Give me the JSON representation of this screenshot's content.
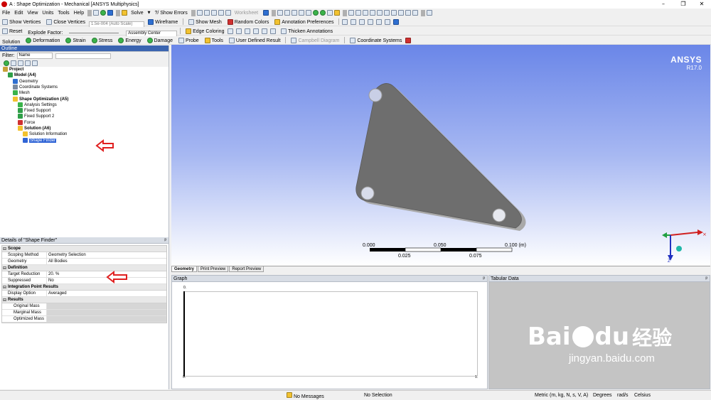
{
  "window": {
    "title": "A : Shape Optimization - Mechanical [ANSYS Multiphysics]",
    "controls": [
      "–",
      "❐",
      "✕"
    ]
  },
  "menu": [
    "File",
    "Edit",
    "View",
    "Units",
    "Tools",
    "Help"
  ],
  "toolbar1": {
    "solve": "Solve",
    "show_errors": "?/ Show Errors",
    "worksheet": "Worksheet"
  },
  "toolbar2": {
    "show_vertices": "Show Vertices",
    "close_vertices": "Close Vertices",
    "auto_scale": "1.5e-004 (Auto Scale)",
    "wireframe": "Wireframe",
    "show_mesh": "Show Mesh",
    "random_colors": "Random Colors",
    "annotation_prefs": "Annotation Preferences"
  },
  "toolbar3": {
    "reset": "Reset",
    "explode_factor": "Explode Factor:",
    "assembly_center": "Assembly Center",
    "edge_coloring": "Edge Coloring",
    "thicken_annotations": "Thicken Annotations"
  },
  "toolbar4": {
    "solution": "Solution",
    "deformation": "Deformation",
    "strain": "Strain",
    "stress": "Stress",
    "energy": "Energy",
    "damage": "Damage",
    "probe": "Probe",
    "tools": "Tools",
    "user_defined_result": "User Defined Result",
    "campbell_diagram": "Campbell Diagram",
    "coordinate_systems": "Coordinate Systems"
  },
  "outline": {
    "header": "Outline",
    "filter_label": "Filter:",
    "filter_value": "Name",
    "tree": [
      {
        "label": "Project",
        "bold": true,
        "depth": 0
      },
      {
        "label": "Model (A4)",
        "bold": true,
        "depth": 1
      },
      {
        "label": "Geometry",
        "bold": false,
        "depth": 2
      },
      {
        "label": "Coordinate Systems",
        "bold": false,
        "depth": 2
      },
      {
        "label": "Mesh",
        "bold": false,
        "depth": 2
      },
      {
        "label": "Shape Optimization (A5)",
        "bold": true,
        "depth": 2
      },
      {
        "label": "Analysis Settings",
        "bold": false,
        "depth": 3
      },
      {
        "label": "Fixed Support",
        "bold": false,
        "depth": 3
      },
      {
        "label": "Fixed Support 2",
        "bold": false,
        "depth": 3
      },
      {
        "label": "Force",
        "bold": false,
        "depth": 3
      },
      {
        "label": "Solution (A6)",
        "bold": true,
        "depth": 3
      },
      {
        "label": "Solution Information",
        "bold": false,
        "depth": 4
      },
      {
        "label": "Shape Finder",
        "bold": false,
        "depth": 4,
        "selected": true
      }
    ]
  },
  "details": {
    "header": "Details of \"Shape Finder\"",
    "pin": "ᵖ",
    "groups": [
      {
        "name": "Scope",
        "rows": [
          {
            "k": "Scoping Method",
            "v": "Geometry Selection"
          },
          {
            "k": "Geometry",
            "v": "All Bodies"
          }
        ]
      },
      {
        "name": "Definition",
        "rows": [
          {
            "k": "Target Reduction",
            "v": "20. %"
          },
          {
            "k": "Suppressed",
            "v": "No"
          }
        ]
      },
      {
        "name": "Integration Point Results",
        "rows": [
          {
            "k": "Display Option",
            "v": "Averaged"
          }
        ]
      },
      {
        "name": "Results",
        "rows": [
          {
            "k": "Original Mass",
            "v": ""
          },
          {
            "k": "Marginal Mass",
            "v": ""
          },
          {
            "k": "Optimized Mass",
            "v": ""
          }
        ]
      }
    ]
  },
  "viewport": {
    "brand": "ANSYS",
    "version": "R17.0",
    "scale_labels_top": [
      "0.000",
      "0.050",
      "0.100 (m)"
    ],
    "scale_labels_bottom": [
      "0.025",
      "0.075"
    ],
    "triad_axis": "Z",
    "tabs": [
      "Geometry",
      "Print Preview",
      "Report Preview"
    ]
  },
  "graph": {
    "header": "Graph",
    "y_tick": "0.",
    "x_start": "0.",
    "x_end": "1."
  },
  "tabular": {
    "header": "Tabular Data"
  },
  "status": {
    "messages": "No Messages",
    "selection": "No Selection",
    "units": "Metric (m, kg, N, s, V, A)",
    "angle": "Degrees",
    "angular_velocity": "rad/s",
    "temperature": "Celsius"
  },
  "watermark": {
    "brand": "Bai",
    "brand2": "du",
    "cn": "经验",
    "url": "jingyan.baidu.com"
  },
  "colors": {
    "accent_red": "#e02020",
    "selection_blue": "#3165d6",
    "viewport_top": "#6a86e8"
  }
}
